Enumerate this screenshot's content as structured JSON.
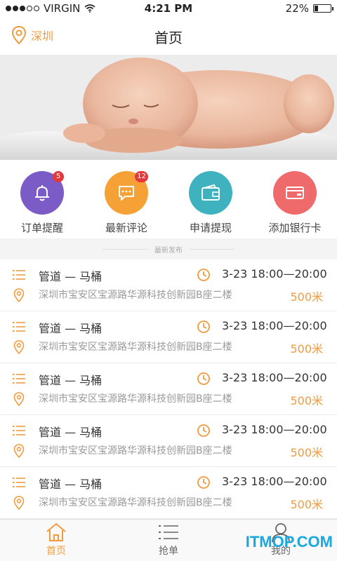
{
  "status": {
    "carrier": "VIRGIN",
    "time": "4:21 PM",
    "battery": "22%",
    "battery_level": 0.22
  },
  "nav": {
    "city": "深圳",
    "title": "首页"
  },
  "quick": [
    {
      "label": "订单提醒",
      "badge": "5",
      "color": "#7b5cc6",
      "icon": "bell-icon"
    },
    {
      "label": "最新评论",
      "badge": "12",
      "color": "#f5a135",
      "icon": "chat-icon"
    },
    {
      "label": "申请提现",
      "badge": "",
      "color": "#3fb2bf",
      "icon": "wallet-icon"
    },
    {
      "label": "添加银行卡",
      "badge": "",
      "color": "#ef6b6b",
      "icon": "card-icon"
    }
  ],
  "section_title": "最新发布",
  "orders": [
    {
      "name": "管道 — 马桶",
      "time": "3-23 18:00—20:00",
      "address": "深圳市宝安区宝源路华源科技创新园B座二楼",
      "distance": "500米"
    },
    {
      "name": "管道 — 马桶",
      "time": "3-23 18:00—20:00",
      "address": "深圳市宝安区宝源路华源科技创新园B座二楼",
      "distance": "500米"
    },
    {
      "name": "管道 — 马桶",
      "time": "3-23 18:00—20:00",
      "address": "深圳市宝安区宝源路华源科技创新园B座二楼",
      "distance": "500米"
    },
    {
      "name": "管道 — 马桶",
      "time": "3-23 18:00—20:00",
      "address": "深圳市宝安区宝源路华源科技创新园B座二楼",
      "distance": "500米"
    },
    {
      "name": "管道 — 马桶",
      "time": "3-23 18:00—20:00",
      "address": "深圳市宝安区宝源路华源科技创新园B座二楼",
      "distance": "500米"
    }
  ],
  "tabs": [
    {
      "label": "首页",
      "icon": "home-icon",
      "active": true
    },
    {
      "label": "抢单",
      "icon": "list-icon",
      "active": false
    },
    {
      "label": "我的",
      "icon": "user-icon",
      "active": false
    }
  ],
  "watermark": "ITMOP.COM",
  "accent": "#f39a3c"
}
